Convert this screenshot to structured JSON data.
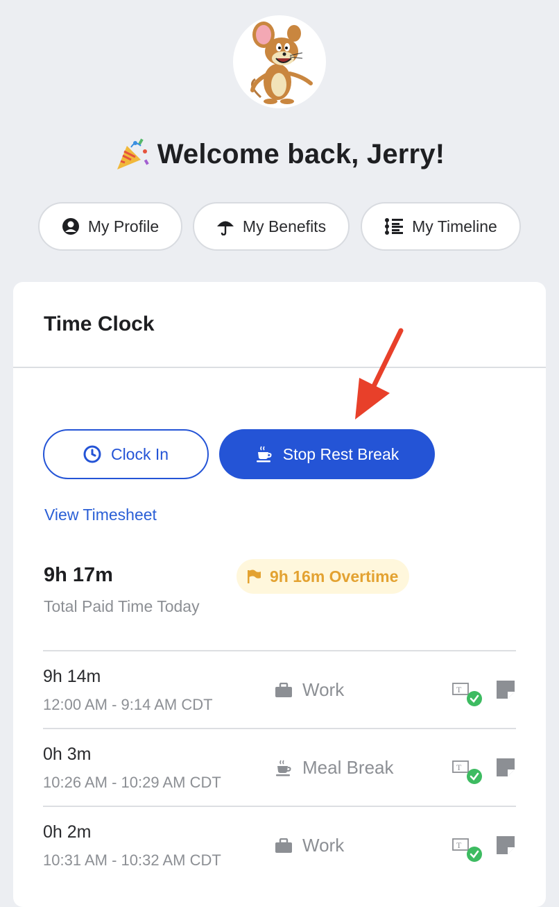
{
  "header": {
    "welcome": "Welcome back, Jerry!"
  },
  "nav_pills": [
    {
      "label": "My Profile",
      "icon": "profile-icon"
    },
    {
      "label": "My Benefits",
      "icon": "umbrella-icon"
    },
    {
      "label": "My Timeline",
      "icon": "timeline-icon"
    }
  ],
  "time_clock": {
    "title": "Time Clock",
    "clock_in_label": "Clock In",
    "stop_break_label": "Stop Rest Break",
    "view_timesheet": "View Timesheet",
    "total_paid": "9h 17m",
    "total_paid_label": "Total Paid Time Today",
    "overtime": "9h 16m Overtime",
    "entries": [
      {
        "duration": "9h 14m",
        "range": "12:00 AM - 9:14 AM CDT",
        "type": "Work",
        "icon": "briefcase-icon"
      },
      {
        "duration": "0h 3m",
        "range": "10:26 AM - 10:29 AM CDT",
        "type": "Meal Break",
        "icon": "coffee-icon"
      },
      {
        "duration": "0h 2m",
        "range": "10:31 AM - 10:32 AM CDT",
        "type": "Work",
        "icon": "briefcase-icon"
      }
    ]
  },
  "colors": {
    "primary": "#2454d6",
    "overtime_text": "#e3a231",
    "overtime_bg": "#fff7dc",
    "check_green": "#3dbb61",
    "annotation_arrow": "#e8402a"
  }
}
